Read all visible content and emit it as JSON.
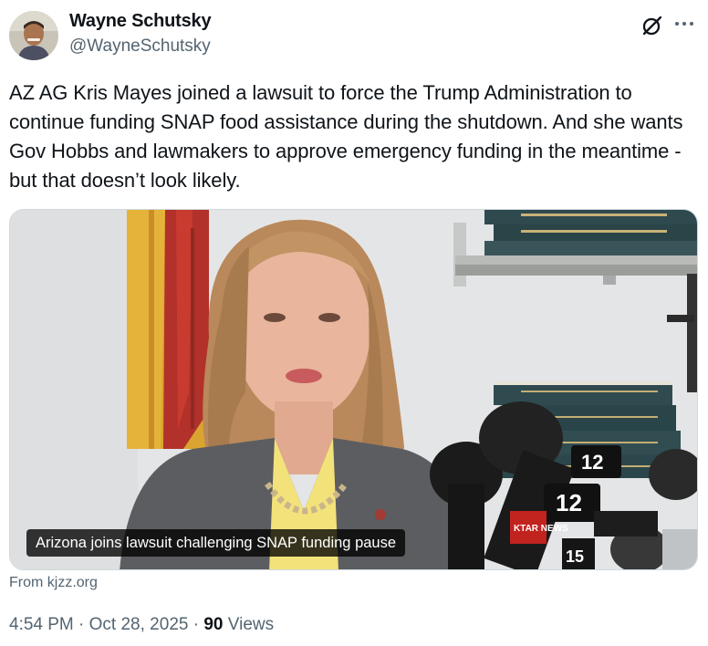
{
  "author": {
    "name": "Wayne Schutsky",
    "handle": "@WayneSchutsky"
  },
  "icons": {
    "grok": "grok-slash-icon",
    "more": "more-horizontal-icon"
  },
  "tweet": {
    "text": "AZ AG Kris Mayes joined a lawsuit to force the Trump Administration to continue funding SNAP food assistance during the shutdown. And she wants Gov Hobbs and lawmakers to approve emergency funding in the meantime - but that doesn’t look likely."
  },
  "card": {
    "caption": "Arizona joins lawsuit challenging SNAP funding pause",
    "source": "From kjzz.org",
    "mic_flag_text_1": "12",
    "mic_flag_text_2": "12",
    "mic_flag_text_3": "KTAR NEWS",
    "mic_flag_text_4": "15"
  },
  "meta": {
    "time": "4:54 PM",
    "separator": " · ",
    "date": "Oct 28, 2025",
    "views_count": "90",
    "views_label": " Views"
  },
  "colors": {
    "text_primary": "#0f1419",
    "text_secondary": "#536471",
    "border": "#cfd9de"
  }
}
